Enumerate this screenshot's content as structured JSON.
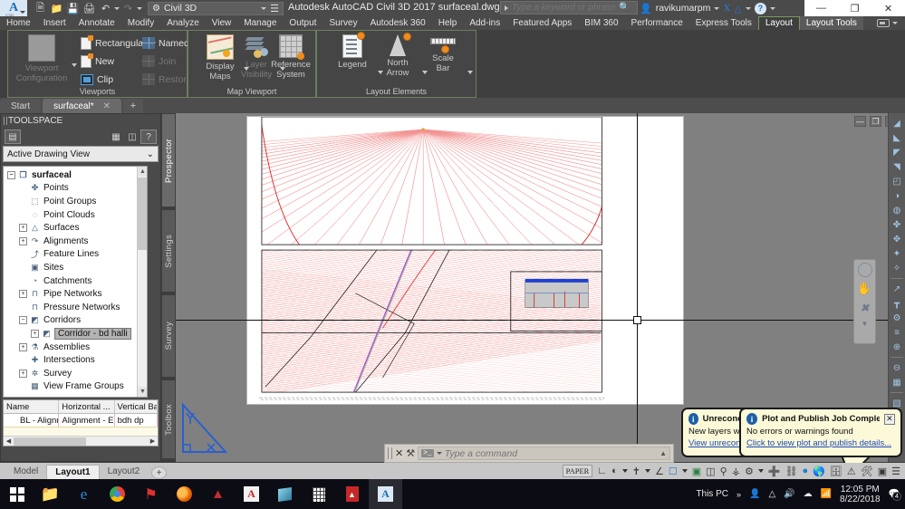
{
  "titlebar": {
    "app_menu_label": "A",
    "app_menu_sub": "C3D",
    "quick_access": [
      "new-icon",
      "open-icon",
      "save-icon",
      "print-icon",
      "undo-icon",
      "redo-icon"
    ],
    "workspace": "Civil 3D",
    "document_title": "Autodesk AutoCAD Civil 3D 2017    surfaceal.dwg",
    "search_placeholder": "Type a keyword or phrase",
    "user_name": "ravikumarpm",
    "window_buttons": {
      "minimize": "—",
      "restore": "❐",
      "close": "✕"
    }
  },
  "ribbon": {
    "tabs": [
      {
        "label": "Home",
        "state": "normal"
      },
      {
        "label": "Insert",
        "state": "normal"
      },
      {
        "label": "Annotate",
        "state": "normal"
      },
      {
        "label": "Modify",
        "state": "normal"
      },
      {
        "label": "Analyze",
        "state": "normal"
      },
      {
        "label": "View",
        "state": "normal"
      },
      {
        "label": "Manage",
        "state": "normal"
      },
      {
        "label": "Output",
        "state": "normal"
      },
      {
        "label": "Survey",
        "state": "normal"
      },
      {
        "label": "Autodesk 360",
        "state": "normal"
      },
      {
        "label": "Help",
        "state": "normal"
      },
      {
        "label": "Add-ins",
        "state": "normal"
      },
      {
        "label": "Featured Apps",
        "state": "normal"
      },
      {
        "label": "BIM 360",
        "state": "normal"
      },
      {
        "label": "Performance",
        "state": "normal"
      },
      {
        "label": "Express Tools",
        "state": "normal"
      },
      {
        "label": "Layout",
        "state": "active"
      },
      {
        "label": "Layout Tools",
        "state": "active2"
      }
    ],
    "panels": [
      {
        "title": "Viewports",
        "big_button": {
          "label_line1": "Viewport",
          "label_line2": "Configuration",
          "enabled": false
        },
        "items": [
          {
            "label": "Rectangular",
            "icon": "page-new-icon",
            "enabled": true,
            "has_dropdown": true
          },
          {
            "label": "New",
            "icon": "page-new-icon",
            "enabled": true,
            "has_dropdown": false
          },
          {
            "label": "Clip",
            "icon": "clip-icon",
            "enabled": true,
            "has_dropdown": false
          },
          {
            "label": "Named",
            "icon": "named-views-icon",
            "enabled": true,
            "has_dropdown": false
          },
          {
            "label": "Join",
            "icon": "join-icon",
            "enabled": false,
            "has_dropdown": false
          },
          {
            "label": "Restore",
            "icon": "restore-icon",
            "enabled": false,
            "has_dropdown": false
          }
        ]
      },
      {
        "title": "Map Viewport",
        "buttons": [
          {
            "label_line1": "Display",
            "label_line2": "Maps",
            "icon": "display-maps-icon",
            "enabled": true,
            "has_dropdown": true
          },
          {
            "label_line1": "Layer",
            "label_line2": "Visibility",
            "icon": "layer-visibility-icon",
            "enabled": false,
            "has_dropdown": true
          },
          {
            "label_line1": "Reference",
            "label_line2": "System",
            "icon": "reference-system-icon",
            "enabled": true,
            "has_dropdown": false
          }
        ]
      },
      {
        "title": "Layout Elements",
        "buttons": [
          {
            "label_line1": "Legend",
            "label_line2": "",
            "icon": "legend-icon",
            "enabled": true,
            "has_dropdown": true
          },
          {
            "label_line1": "North",
            "label_line2": "Arrow",
            "icon": "north-arrow-icon",
            "enabled": true,
            "has_dropdown": true
          },
          {
            "label_line1": "Scale",
            "label_line2": "Bar",
            "icon": "scale-bar-icon",
            "enabled": true,
            "has_dropdown": true
          }
        ]
      }
    ]
  },
  "file_tabs": {
    "tabs": [
      {
        "label": "Start",
        "active": false,
        "closeable": false
      },
      {
        "label": "surfaceal*",
        "active": true,
        "closeable": true
      }
    ],
    "add_label": "+",
    "close_glyph": "✕"
  },
  "toolspace": {
    "title": "TOOLSPACE",
    "toolbar_icons": [
      "active-drawing-icon",
      "data-shortcuts-icon",
      "panorama-icon",
      "help-icon"
    ],
    "help_label": "?",
    "view_selector": "Active Drawing View",
    "chevron": "⌄",
    "tree": [
      {
        "label": "surfaceal",
        "depth": 0,
        "expander": "minus",
        "icon": "drawing-icon",
        "bold": true,
        "selected": false
      },
      {
        "label": "Points",
        "depth": 1,
        "expander": "none",
        "icon": "points-icon",
        "bold": false,
        "selected": false
      },
      {
        "label": "Point Groups",
        "depth": 1,
        "expander": "none",
        "icon": "point-groups-icon",
        "bold": false,
        "selected": false
      },
      {
        "label": "Point Clouds",
        "depth": 1,
        "expander": "none",
        "icon": "point-clouds-icon",
        "bold": false,
        "selected": false
      },
      {
        "label": "Surfaces",
        "depth": 1,
        "expander": "plus",
        "icon": "surfaces-icon",
        "bold": false,
        "selected": false
      },
      {
        "label": "Alignments",
        "depth": 1,
        "expander": "plus",
        "icon": "alignments-icon",
        "bold": false,
        "selected": false
      },
      {
        "label": "Feature Lines",
        "depth": 1,
        "expander": "none",
        "icon": "feature-lines-icon",
        "bold": false,
        "selected": false
      },
      {
        "label": "Sites",
        "depth": 1,
        "expander": "none",
        "icon": "sites-icon",
        "bold": false,
        "selected": false
      },
      {
        "label": "Catchments",
        "depth": 1,
        "expander": "none",
        "icon": "catchments-icon",
        "bold": false,
        "selected": false
      },
      {
        "label": "Pipe Networks",
        "depth": 1,
        "expander": "plus",
        "icon": "pipe-networks-icon",
        "bold": false,
        "selected": false
      },
      {
        "label": "Pressure Networks",
        "depth": 1,
        "expander": "none",
        "icon": "pressure-networks-icon",
        "bold": false,
        "selected": false
      },
      {
        "label": "Corridors",
        "depth": 1,
        "expander": "minus",
        "icon": "corridors-icon",
        "bold": false,
        "selected": false
      },
      {
        "label": "Corridor - bd halli",
        "depth": 2,
        "expander": "plus",
        "icon": "corridor-icon",
        "bold": false,
        "selected": true
      },
      {
        "label": "Assemblies",
        "depth": 1,
        "expander": "plus",
        "icon": "assemblies-icon",
        "bold": false,
        "selected": false
      },
      {
        "label": "Intersections",
        "depth": 1,
        "expander": "none",
        "icon": "intersections-icon",
        "bold": false,
        "selected": false
      },
      {
        "label": "Survey",
        "depth": 1,
        "expander": "plus",
        "icon": "survey-icon",
        "bold": false,
        "selected": false
      },
      {
        "label": "View Frame Groups",
        "depth": 1,
        "expander": "none",
        "icon": "view-frame-groups-icon",
        "bold": false,
        "selected": false
      }
    ],
    "grid": {
      "headers": [
        "Name",
        "Horizontal ...",
        "Vertical Ba"
      ],
      "rows": [
        [
          "BL - Alignn",
          "Alignment - E",
          "bdh dp"
        ]
      ]
    },
    "vertical_tabs": [
      {
        "label": "Prospector",
        "active": true
      },
      {
        "label": "Settings",
        "active": false
      },
      {
        "label": "Survey",
        "active": false
      },
      {
        "label": "Toolbox",
        "active": false
      }
    ]
  },
  "canvas": {
    "viewport_buttons": {
      "minimize": "—",
      "restore": "❐",
      "close": "✕"
    },
    "navbar_icons": [
      "steering-wheel-icon",
      "pan-hand-icon",
      "zoom-orbit-icon"
    ],
    "right_toolbar_icons": [
      "create-surface-icon",
      "surface-contours-icon",
      "grading-icon",
      "surface-tools-icon",
      "parcel-icon",
      "geolocation-icon",
      "globe-icon",
      "point-create-icon",
      "point-annotate-icon",
      "point-edit-icon",
      "point-group-icon",
      "feature-line-icon",
      "profile-icon",
      "assembly-icon",
      "corridor-section-icon",
      "pipe-layout-icon",
      "structure-icon",
      "section-view-icon",
      "quantity-takeoff-icon",
      "plan-production-icon"
    ]
  },
  "command_line": {
    "placeholder": "Type a command",
    "prompt_glyph": "⌫",
    "close_glyph": "✕",
    "tools_glyph": "⚒"
  },
  "notifications": [
    {
      "title": "Unreconciled New Layers",
      "message": "New layers were found",
      "link": "View unreconciled new layers",
      "icon": "info-icon",
      "closeable": false
    },
    {
      "title": "Plot and Publish Job Complete",
      "message": "No errors or warnings found",
      "link": "Click to view plot and publish details...",
      "icon": "info-icon",
      "closeable": true,
      "close_glyph": "✕"
    }
  ],
  "layout_bar": {
    "tabs": [
      {
        "label": "Model",
        "active": false
      },
      {
        "label": "Layout1",
        "active": true
      },
      {
        "label": "Layout2",
        "active": false
      }
    ],
    "add_label": "+",
    "space_badge": "PAPER",
    "status_icons": [
      "ortho-icon",
      "polar-tracking-icon",
      "osnap-icon",
      "angle-icon",
      "isometric-icon",
      "object-snap-tracking-icon",
      "annotation-visibility-icon",
      "annotation-scale-icon",
      "annotation-add-icon",
      "workspace-gear-icon",
      "add-icon",
      "lock-ui-icon",
      "isolate-objects-icon",
      "hardware-accel-icon",
      "clean-screen-icon",
      "performance-warning-icon",
      "hardware-warn-icon",
      "fullscreen-icon",
      "customize-icon"
    ]
  },
  "taskbar": {
    "start_label": "start-windows-icon",
    "apps": [
      {
        "name": "file-explorer-icon",
        "active": false
      },
      {
        "name": "microsoft-edge-icon",
        "active": false
      },
      {
        "name": "google-chrome-icon",
        "active": false
      },
      {
        "name": "autodesk-app-icon",
        "active": false
      },
      {
        "name": "mozilla-firefox-icon",
        "active": false
      },
      {
        "name": "adobe-reader-icon",
        "active": false
      },
      {
        "name": "autocad-icon",
        "active": false
      },
      {
        "name": "onenote-icon",
        "active": false
      },
      {
        "name": "calculator-icon",
        "active": false
      },
      {
        "name": "pdf-icon",
        "active": false
      },
      {
        "name": "civil3d-icon",
        "active": true
      }
    ],
    "tray": {
      "this_pc_label": "This PC",
      "overflow_glyph": "»",
      "icons": [
        "people-icon",
        "chevron-up-icon",
        "volume-icon",
        "onedrive-icon",
        "wifi-icon"
      ],
      "time": "12:05 PM",
      "date": "8/22/2018",
      "notification_count": "4"
    }
  }
}
